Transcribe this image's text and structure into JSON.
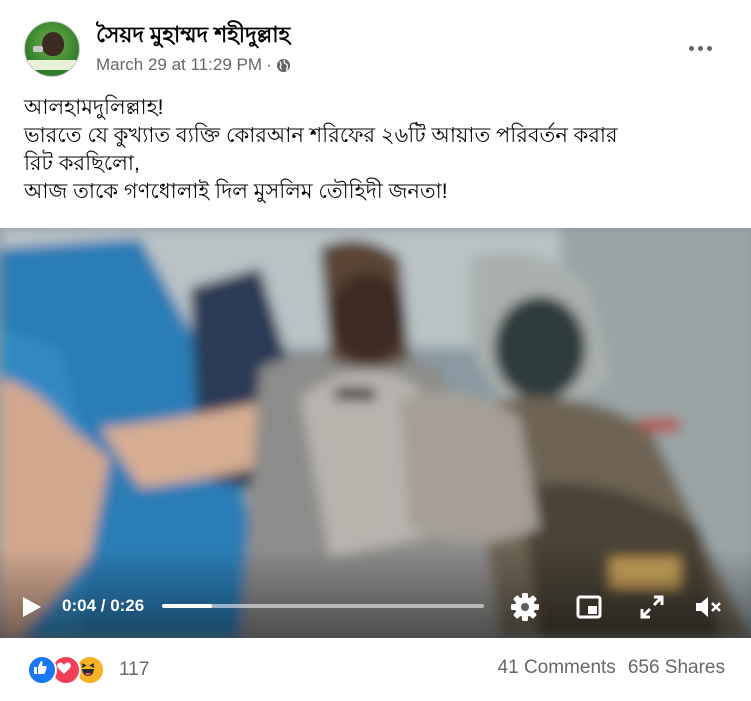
{
  "post": {
    "author": "সৈয়দ মুহাম্মদ শহীদুল্লাহ",
    "timestamp": "March 29 at 11:29 PM",
    "separator": "·",
    "audience_icon": "globe-icon",
    "more_icon": "more-options-icon",
    "caption_lines": [
      "আলহামদুলিল্লাহ!",
      "ভারতে যে কুখ্যাত ব্যক্তি কোরআন শরিফের ২৬টি আয়াত পরিবর্তন করার",
      "রিট করছিলো,",
      "আজ তাকে গণধোলাই দিল মুসলিম তৌহিদী জনতা!"
    ]
  },
  "video": {
    "current_time": "0:04",
    "duration": "0:26",
    "time_display": "0:04 / 0:26",
    "progress_fraction": 0.1538,
    "icons": [
      "play-icon",
      "gear-icon",
      "pip-icon",
      "expand-icon",
      "volume-icon"
    ]
  },
  "footer": {
    "reaction_icons": [
      "like-icon",
      "love-icon",
      "haha-icon"
    ],
    "reaction_count": "117",
    "comments": "41 Comments",
    "shares": "656 Shares"
  },
  "colors": {
    "text_primary": "#050505",
    "text_secondary": "#65676b",
    "like_blue": "#1877f2",
    "love_red": "#f33e58",
    "haha_yellow": "#f7b125"
  }
}
